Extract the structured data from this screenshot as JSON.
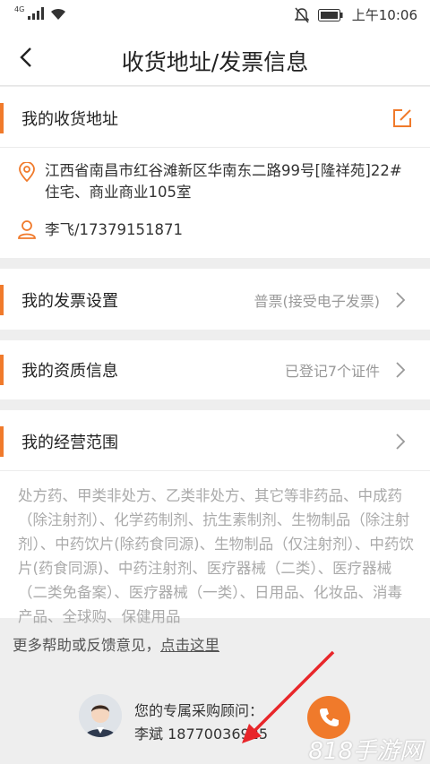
{
  "status_bar": {
    "network": "4G",
    "time": "上午10:06"
  },
  "header": {
    "title": "收货地址/发票信息"
  },
  "address_section": {
    "title": "我的收货地址",
    "address_line1": "江西省南昌市红谷滩新区华南东二路99号[隆祥苑]22#",
    "address_line2": "住宅、商业商业105室",
    "contact": "李飞/17379151871"
  },
  "invoice_section": {
    "title": "我的发票设置",
    "value": "普票(接受电子发票)"
  },
  "qualification_section": {
    "title": "我的资质信息",
    "value": "已登记7个证件"
  },
  "business_scope_section": {
    "title": "我的经营范围",
    "text": "处方药、甲类非处方、乙类非处方、其它等非药品、中成药（除注射剂）、化学药制剂、抗生素制剂、生物制品（除注射剂）、中药饮片(除药食同源)、生物制品（仅注射剂）、中药饮片(药食同源)、中药注射剂、医疗器械（二类）、医疗器械（二类免备案）、医疗器械（一类）、日用品、化妆品、消毒产品、全球购、保健用品"
  },
  "help": {
    "prefix": "更多帮助或反馈意见，",
    "link": "点击这里"
  },
  "advisor": {
    "label": "您的专属采购顾问：",
    "contact": "李斌 18770036925"
  },
  "watermark": "818手游网",
  "colors": {
    "accent": "#f07a2b",
    "annotation_arrow": "#e8262a"
  }
}
